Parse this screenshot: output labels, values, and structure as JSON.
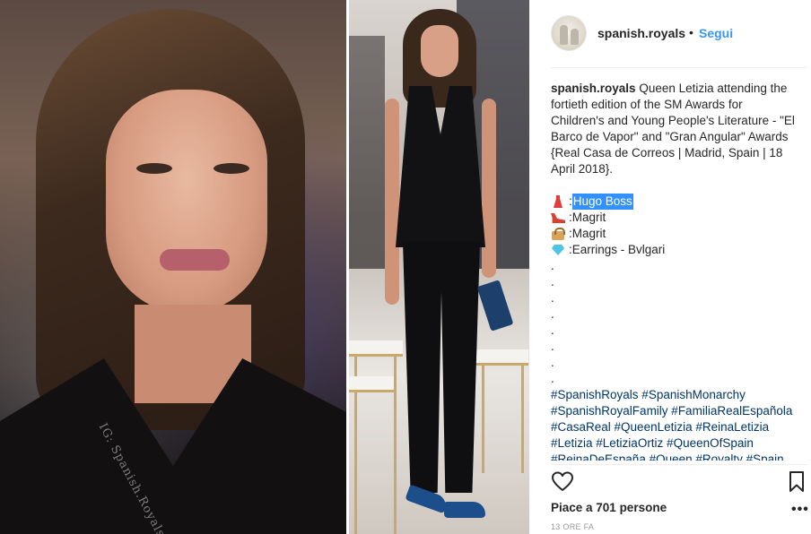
{
  "post": {
    "watermark": "IG: Spanish.Royals",
    "icons": {
      "heart": "heart-icon",
      "bookmark": "bookmark-icon",
      "more": "more-options-icon"
    }
  },
  "header": {
    "username": "spanish.royals",
    "separator": "•",
    "follow_label": "Segui"
  },
  "caption": {
    "username": "spanish.royals",
    "text": "Queen Letizia attending the fortieth edition of the SM Awards for Children's and Young People's Literature - \"El Barco de Vapor\" and \"Gran Angular\" Awards {Real Casa de Correos | Madrid, Spain | 18 April 2018}.",
    "items": [
      {
        "icon": "dress-emoji",
        "prefix": ": ",
        "label": "Hugo Boss",
        "highlighted": true
      },
      {
        "icon": "high-heel-emoji",
        "prefix": ": ",
        "label": "Magrit"
      },
      {
        "icon": "handbag-emoji",
        "prefix": ": ",
        "label": "Magrit"
      },
      {
        "icon": "gem-emoji",
        "prefix": ": ",
        "label": "Earrings - Bvlgari"
      }
    ],
    "dot": ".",
    "hashtag_lines": [
      "#SpanishRoyals #SpanishMonarchy",
      "#SpanishRoyalFamily #FamiliaRealEspañola",
      "#CasaReal #QueenLetizia #ReinaLetizia",
      "#Letizia #LetiziaOrtiz #QueenOfSpain",
      "#ReinaDeEspaña #Queen #Royalty #Spain"
    ]
  },
  "footer": {
    "likes": "Piace a 701 persone",
    "time": "13 ORE FA",
    "more": "•••"
  },
  "colors": {
    "link_blue": "#3897f0",
    "hashtag_blue": "#003569",
    "highlight": "#3390ff",
    "text": "#262626",
    "muted": "#999999"
  }
}
